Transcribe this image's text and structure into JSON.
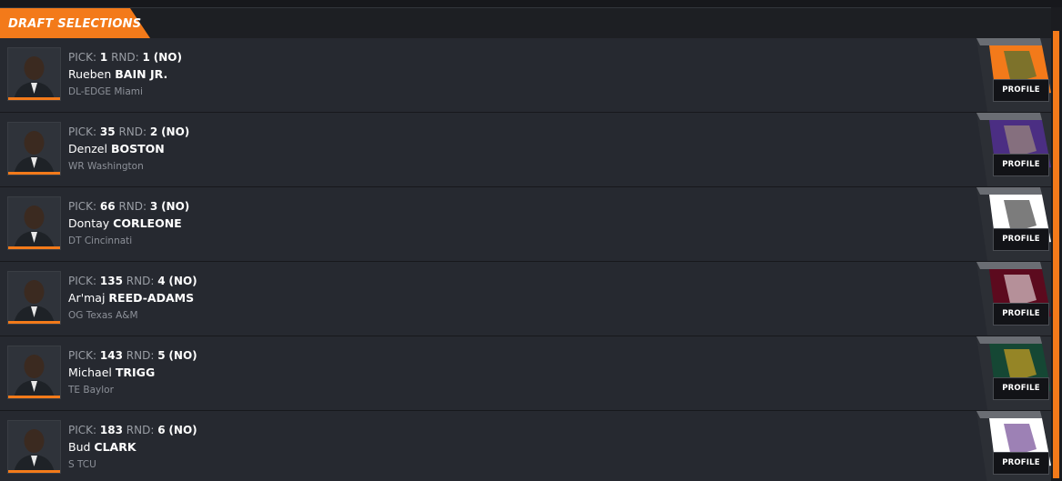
{
  "header": {
    "title": "DRAFT SELECTIONS"
  },
  "labels": {
    "pick": "PICK:",
    "round": "RND:",
    "profile": "PROFILE"
  },
  "colors": {
    "accent": "#f37a1a"
  },
  "picks": [
    {
      "pick": "1",
      "round": "1",
      "team": "(NO)",
      "first": "Rueben",
      "last": "BAIN JR.",
      "position_school": "DL-EDGE Miami",
      "logo_color": "#f37a1a",
      "logo_accent": "#1b6b3a"
    },
    {
      "pick": "35",
      "round": "2",
      "team": "(NO)",
      "first": "Denzel",
      "last": "BOSTON",
      "position_school": "WR Washington",
      "logo_color": "#4b2e83",
      "logo_accent": "#b7a57a"
    },
    {
      "pick": "66",
      "round": "3",
      "team": "(NO)",
      "first": "Dontay",
      "last": "CORLEONE",
      "position_school": "DT Cincinnati",
      "logo_color": "#ffffff",
      "logo_accent": "#111111"
    },
    {
      "pick": "135",
      "round": "4",
      "team": "(NO)",
      "first": "Ar'maj",
      "last": "REED-ADAMS",
      "position_school": "OG Texas A&M",
      "logo_color": "#5c0a1e",
      "logo_accent": "#ffffff"
    },
    {
      "pick": "143",
      "round": "5",
      "team": "(NO)",
      "first": "Michael",
      "last": "TRIGG",
      "position_school": "TE Baylor",
      "logo_color": "#154734",
      "logo_accent": "#ffb81c"
    },
    {
      "pick": "183",
      "round": "6",
      "team": "(NO)",
      "first": "Bud",
      "last": "CLARK",
      "position_school": "S TCU",
      "logo_color": "#ffffff",
      "logo_accent": "#4d1979"
    }
  ]
}
